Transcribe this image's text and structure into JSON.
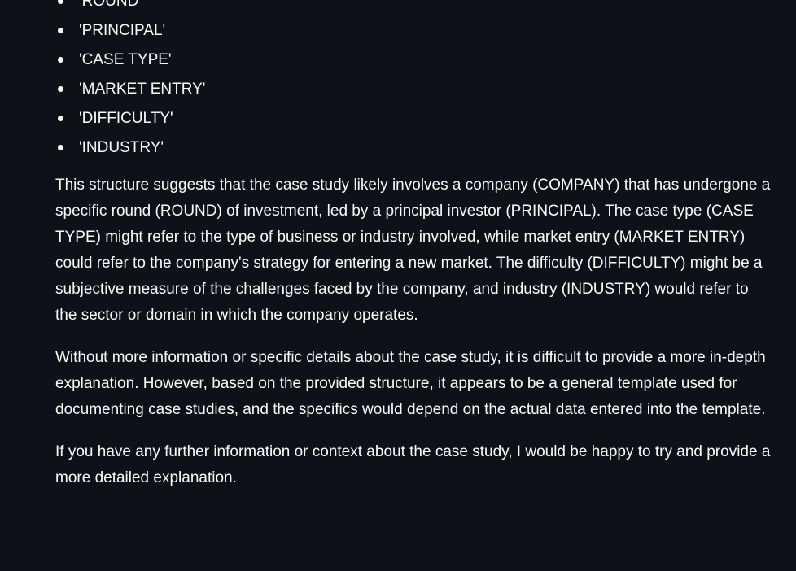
{
  "list_items": [
    "'ROUND'",
    "'PRINCIPAL'",
    "'CASE TYPE'",
    "'MARKET ENTRY'",
    "'DIFFICULTY'",
    "'INDUSTRY'"
  ],
  "paragraphs": [
    "This structure suggests that the case study likely involves a company (COMPANY) that has undergone a specific round (ROUND) of investment, led by a principal investor (PRINCIPAL). The case type (CASE TYPE) might refer to the type of business or industry involved, while market entry (MARKET ENTRY) could refer to the company's strategy for entering a new market. The difficulty (DIFFICULTY) might be a subjective measure of the challenges faced by the company, and industry (INDUSTRY) would refer to the sector or domain in which the company operates.",
    "Without more information or specific details about the case study, it is difficult to provide a more in-depth explanation. However, based on the provided structure, it appears to be a general template used for documenting case studies, and the specifics would depend on the actual data entered into the template.",
    "If you have any further information or context about the case study, I would be happy to try and provide a more detailed explanation."
  ]
}
